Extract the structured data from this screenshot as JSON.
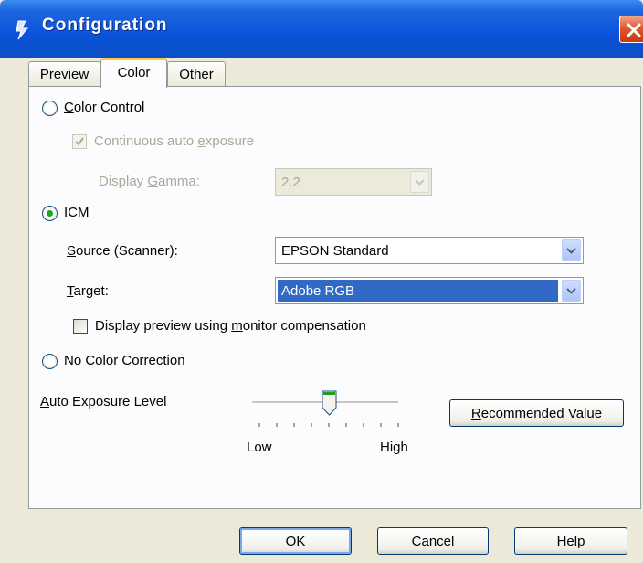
{
  "window": {
    "title": "Configuration",
    "app_icon": "scanner-icon",
    "close_icon": "close-icon"
  },
  "tabs": [
    {
      "label": "Preview",
      "active": false
    },
    {
      "label": "Color",
      "active": true
    },
    {
      "label": "Other",
      "active": false
    }
  ],
  "color_control": {
    "radio_label_accel": "C",
    "radio_label_rest": "olor Control",
    "selected": false,
    "continuous_label_a": "Continuous auto ",
    "continuous_label_accel": "e",
    "continuous_label_b": "xposure",
    "continuous_checked": true,
    "gamma_label_a": "Display ",
    "gamma_label_accel": "G",
    "gamma_label_b": "amma:",
    "gamma_value": "2.2"
  },
  "icm": {
    "radio_label_accel": "I",
    "radio_label_rest": "CM",
    "selected": true,
    "source_label_accel": "S",
    "source_label_rest": "ource (Scanner):",
    "source_value": "EPSON Standard",
    "target_label_accel": "T",
    "target_label_rest": "arget:",
    "target_value": "Adobe RGB",
    "preview_label_a": "Display preview using ",
    "preview_label_accel": "m",
    "preview_label_b": "onitor compensation",
    "preview_checked": false
  },
  "no_color": {
    "radio_label_accel": "N",
    "radio_label_rest": "o Color Correction",
    "selected": false
  },
  "auto_exposure": {
    "label_accel": "A",
    "label_rest": "uto Exposure Level",
    "level": 0.5,
    "low_label": "Low",
    "high_label": "High",
    "recommended_accel": "R",
    "recommended_rest": "ecommended Value"
  },
  "buttons": {
    "ok": "OK",
    "cancel": "Cancel",
    "help_accel": "H",
    "help_rest": "elp"
  },
  "colors": {
    "titlebar": "#0a52d8",
    "selection": "#316ac5",
    "radio_dot": "#21a121"
  }
}
